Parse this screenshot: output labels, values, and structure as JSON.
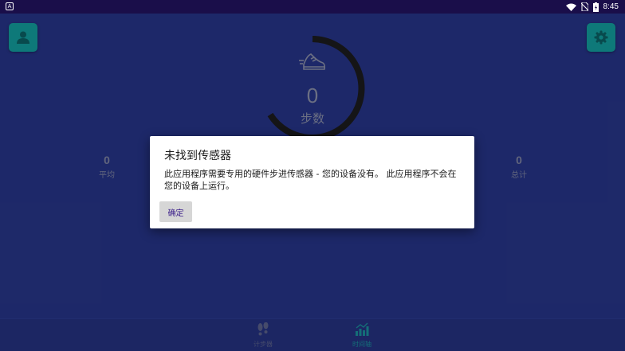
{
  "status_bar": {
    "time": "8:45",
    "notification_icon": "a-square-icon",
    "icons": [
      "wifi-icon",
      "no-sim-icon",
      "battery-charging-icon"
    ]
  },
  "app": {
    "steps": {
      "value": "0",
      "label": "步数"
    },
    "stats": {
      "average": {
        "value": "0",
        "label": "平均"
      },
      "total": {
        "value": "0",
        "label": "总计"
      }
    },
    "nav": [
      {
        "label": "计步器",
        "icon": "footprints-icon"
      },
      {
        "label": "时间轴",
        "icon": "bar-chart-icon"
      }
    ],
    "colors": {
      "accent": "#129c9c",
      "background": "#263487"
    }
  },
  "dialog": {
    "title": "未找到传感器",
    "message": "此应用程序需要专用的硬件步进传感器 - 您的设备没有。 此应用程序不会在您的设备上运行。",
    "ok_label": "确定"
  }
}
